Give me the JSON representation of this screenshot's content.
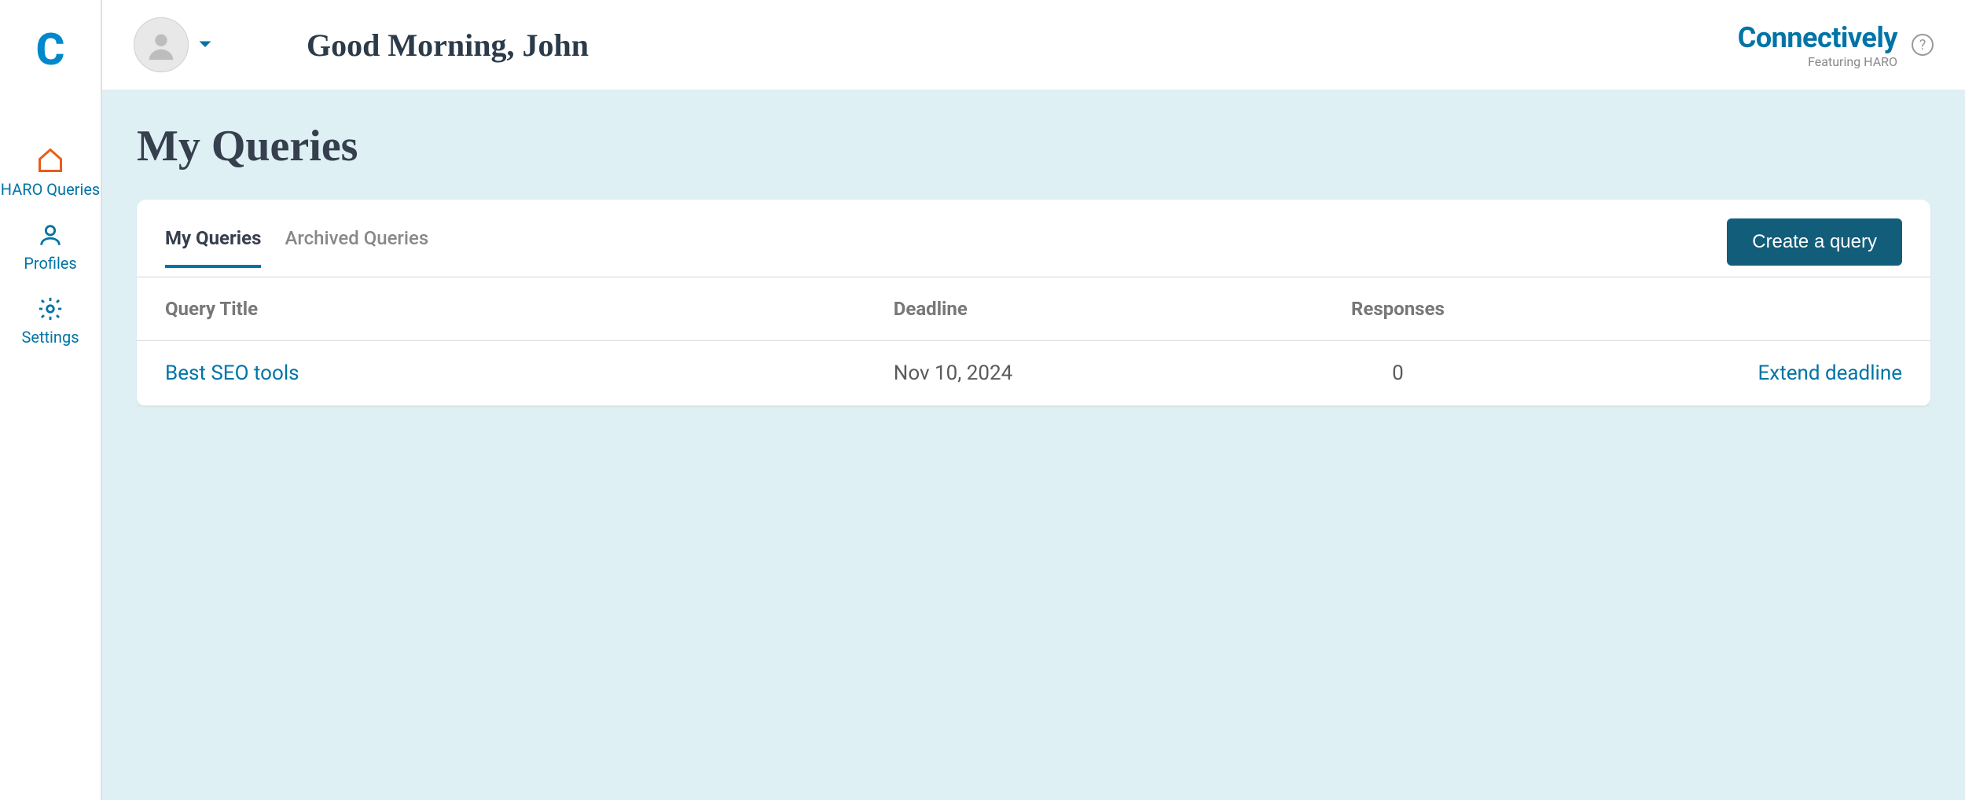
{
  "sidebar": {
    "items": [
      {
        "label": "HARO Queries"
      },
      {
        "label": "Profiles"
      },
      {
        "label": "Settings"
      }
    ]
  },
  "header": {
    "greeting": "Good Morning, John",
    "brand": "Connectively",
    "brand_sub": "Featuring HARO"
  },
  "page": {
    "title": "My Queries"
  },
  "tabs": [
    {
      "label": "My Queries",
      "active": true
    },
    {
      "label": "Archived Queries",
      "active": false
    }
  ],
  "buttons": {
    "create": "Create a query"
  },
  "table": {
    "headers": {
      "title": "Query Title",
      "deadline": "Deadline",
      "responses": "Responses"
    },
    "rows": [
      {
        "title": "Best SEO tools",
        "deadline": "Nov 10, 2024",
        "responses": "0",
        "action": "Extend deadline"
      }
    ]
  }
}
